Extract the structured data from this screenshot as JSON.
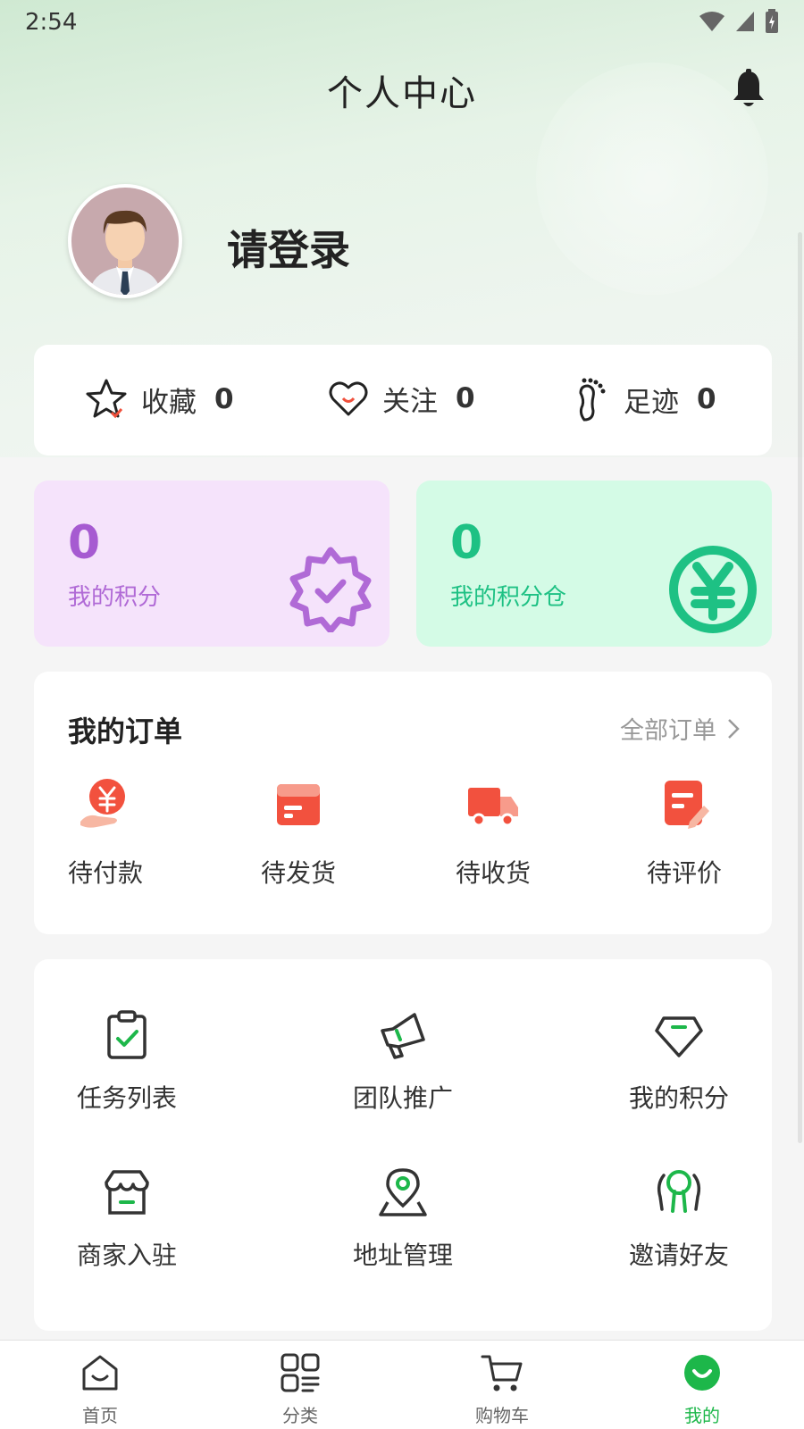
{
  "status_bar": {
    "time": "2:54"
  },
  "header": {
    "title": "个人中心"
  },
  "profile": {
    "login_text": "请登录"
  },
  "stats": [
    {
      "label": "收藏",
      "count": "0",
      "icon": "star-icon"
    },
    {
      "label": "关注",
      "count": "0",
      "icon": "heart-icon"
    },
    {
      "label": "足迹",
      "count": "0",
      "icon": "footprint-icon"
    }
  ],
  "points": {
    "my_points": {
      "value": "0",
      "label": "我的积分",
      "color": "#a65bd1",
      "bg": "#f5e3fb",
      "icon": "badge-check-icon"
    },
    "points_warehouse": {
      "value": "0",
      "label": "我的积分仓",
      "color": "#1ec184",
      "bg": "#d4fbe6",
      "icon": "yen-coin-icon"
    }
  },
  "orders": {
    "title": "我的订单",
    "all_label": "全部订单",
    "items": [
      {
        "label": "待付款",
        "icon": "payment-icon"
      },
      {
        "label": "待发货",
        "icon": "box-icon"
      },
      {
        "label": "待收货",
        "icon": "truck-icon"
      },
      {
        "label": "待评价",
        "icon": "review-icon"
      }
    ]
  },
  "menu": {
    "items": [
      {
        "label": "任务列表",
        "icon": "clipboard-check-icon"
      },
      {
        "label": "团队推广",
        "icon": "megaphone-icon"
      },
      {
        "label": "我的积分",
        "icon": "diamond-icon"
      },
      {
        "label": "商家入驻",
        "icon": "store-icon"
      },
      {
        "label": "地址管理",
        "icon": "location-pin-icon"
      },
      {
        "label": "邀请好友",
        "icon": "invite-friends-icon"
      }
    ]
  },
  "tabbar": {
    "items": [
      {
        "label": "首页",
        "icon": "home-icon"
      },
      {
        "label": "分类",
        "icon": "category-icon"
      },
      {
        "label": "购物车",
        "icon": "cart-icon"
      },
      {
        "label": "我的",
        "icon": "profile-icon"
      }
    ],
    "active": "我的"
  },
  "colors": {
    "accent": "#1db74a",
    "order_red": "#f2513e"
  }
}
